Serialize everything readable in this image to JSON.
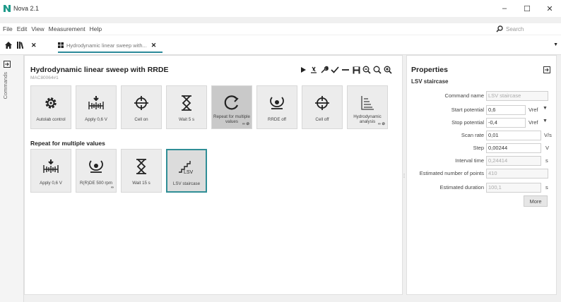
{
  "window": {
    "title": "Nova 2.1",
    "minimize": "–",
    "maximize": "☐",
    "close": "✕"
  },
  "menu": [
    "File",
    "Edit",
    "View",
    "Measurement",
    "Help"
  ],
  "search": {
    "placeholder": "Search"
  },
  "tabs": {
    "active_label": "Hydrodynamic linear sweep with...",
    "close": "✕",
    "overflow": "▼"
  },
  "sidebar": {
    "label": "Commands"
  },
  "procedure": {
    "title": "Hydrodynamic linear sweep with RRDE",
    "id": "MAC80064#1"
  },
  "tiles_main": [
    {
      "label": "Autolab control",
      "icon": "gear-icon"
    },
    {
      "label": "Apply 0,6 V",
      "icon": "apply-potential-icon"
    },
    {
      "label": "Cell on",
      "icon": "cell-on-icon"
    },
    {
      "label": "Wait 5 s",
      "icon": "hourglass-icon"
    },
    {
      "label": "Repeat for multiple values",
      "icon": "repeat-icon",
      "badge": "∞ ⊘"
    },
    {
      "label": "RRDE off",
      "icon": "rotator-icon"
    },
    {
      "label": "Cell off",
      "icon": "cell-off-icon"
    },
    {
      "label": "Hydrodynamic analysis",
      "icon": "analysis-icon",
      "badge": "∞ ⊘"
    }
  ],
  "section": {
    "title": "Repeat for multiple values"
  },
  "tiles_repeat": [
    {
      "label": "Apply 0,6 V",
      "icon": "apply-potential-icon"
    },
    {
      "label": "R(R)DE 500 rpm",
      "icon": "rotator-icon",
      "badge": "∞"
    },
    {
      "label": "Wait 15 s",
      "icon": "hourglass-icon"
    },
    {
      "label": "LSV staircase",
      "icon": "lsv-icon",
      "icon_text": "LSV"
    }
  ],
  "properties": {
    "title": "Properties",
    "subtitle": "LSV staircase",
    "rows": [
      {
        "label": "Command name",
        "value": "LSV staircase",
        "unit": ""
      },
      {
        "label": "Start potential",
        "value": "0,6",
        "unit": "Vref"
      },
      {
        "label": "Stop potential",
        "value": "-0,4",
        "unit": "Vref"
      },
      {
        "label": "Scan rate",
        "value": "0,01",
        "unit": "V/s"
      },
      {
        "label": "Step",
        "value": "0,00244",
        "unit": "V"
      },
      {
        "label": "Interval time",
        "value": "0,24414",
        "unit": "s"
      },
      {
        "label": "Estimated number of points",
        "value": "410",
        "unit": ""
      },
      {
        "label": "Estimated duration",
        "value": "100,1",
        "unit": "s"
      }
    ],
    "more_label": "More"
  },
  "colors": {
    "accent": "#2f8e96",
    "logo": "#1f9a8a"
  }
}
